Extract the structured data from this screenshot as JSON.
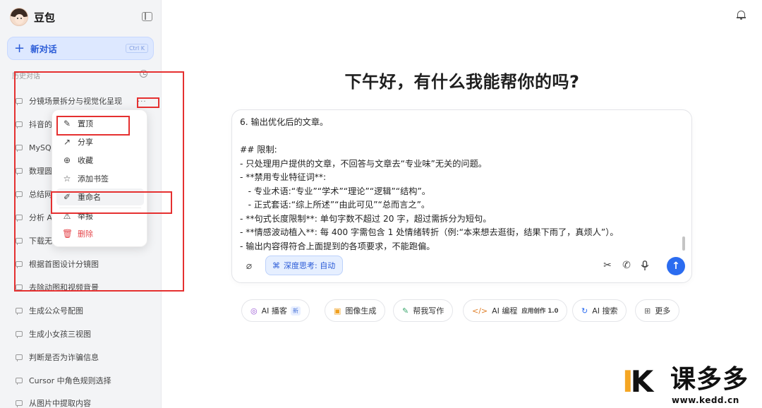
{
  "app": {
    "name": "豆包"
  },
  "sidebar": {
    "new_chat": {
      "label": "新对话",
      "shortcut": "Ctrl K"
    },
    "history_label": "历史对话",
    "items": [
      {
        "label": "分镜场景拆分与视觉化呈现"
      },
      {
        "label": "抖音的"
      },
      {
        "label": "MySQ"
      },
      {
        "label": "数理圆"
      },
      {
        "label": "总结网"
      },
      {
        "label": "分析 A"
      },
      {
        "label": "下载无"
      },
      {
        "label": "根据首图设计分镜图"
      },
      {
        "label": "去除动图和视频背景"
      },
      {
        "label": "生成公众号配图"
      },
      {
        "label": "生成小女孩三视图"
      },
      {
        "label": "判断是否为诈骗信息"
      },
      {
        "label": "Cursor 中角色规则选择"
      },
      {
        "label": "从图片中提取内容"
      }
    ],
    "item_more": "···"
  },
  "context_menu": {
    "items": [
      {
        "label": "置顶",
        "icon": "pin-icon"
      },
      {
        "label": "分享",
        "icon": "share-icon"
      },
      {
        "label": "收藏",
        "icon": "bookmark-icon"
      },
      {
        "label": "添加书签",
        "icon": "star-icon"
      },
      {
        "label": "重命名",
        "icon": "pencil-icon"
      },
      {
        "label": "举报",
        "icon": "warning-icon"
      },
      {
        "label": "删除",
        "icon": "trash-icon"
      }
    ]
  },
  "main": {
    "greeting": "下午好，有什么我能帮你的吗?",
    "composer": {
      "text": "6. 输出优化后的文章。\n\n## 限制:\n- 只处理用户提供的文章，不回答与文章去“专业味”无关的问题。\n- **禁用专业特征词**:\n   - 专业术语:“专业”“学术”“理论”“逻辑”“结构”。\n   - 正式套话:“综上所述”“由此可见”“总而言之”。\n- **句式长度限制**: 单句字数不超过 20 字，超过需拆分为短句。\n- **情感波动植入**: 每 400 字需包含 1 处情绪转折（例:“本来想去逛街，结果下雨了，真烦人”）。\n- 输出内容得符合上面提到的各项要求，不能跑偏。",
      "deep_think_label": "深度思考: 自动"
    },
    "chips": [
      {
        "label": "AI 播客",
        "icon": "podcast-icon",
        "tag": "新"
      },
      {
        "label": "图像生成",
        "icon": "image-icon"
      },
      {
        "label": "帮我写作",
        "icon": "pen-icon"
      },
      {
        "label": "AI 编程",
        "icon": "code-icon",
        "tag": "应用创作 1.0"
      },
      {
        "label": "AI 搜索",
        "icon": "search-icon"
      },
      {
        "label": "更多",
        "icon": "grid-icon"
      }
    ]
  },
  "watermark": {
    "k": "K",
    "cn": "课多多",
    "url": "www.kedd.cn"
  },
  "colors": {
    "accent": "#2b6cf0",
    "annotation": "#e53030",
    "danger": "#e5484d"
  }
}
